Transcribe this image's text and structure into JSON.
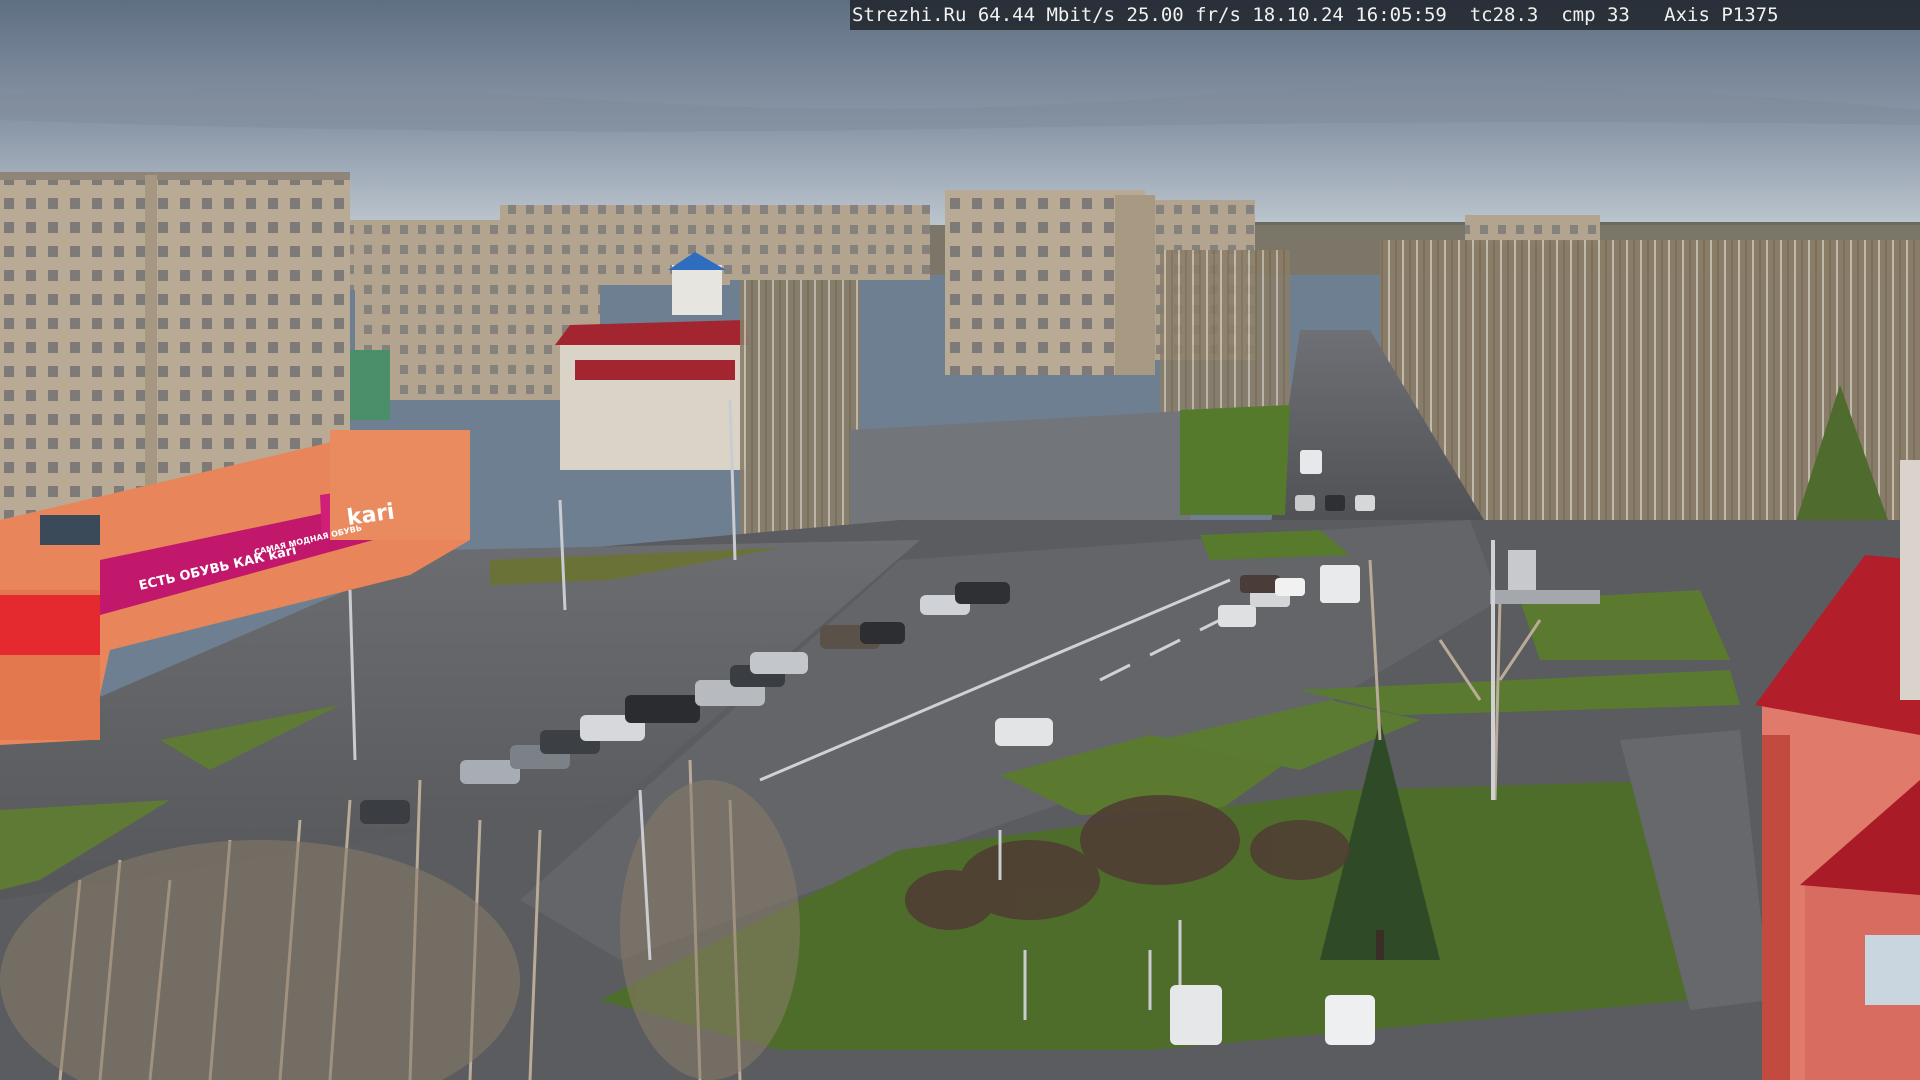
{
  "overlay": {
    "text": "Strezhi.Ru 64.44 Mbit/s 25.00 fr/s 18.10.24 16:05:59  tc28.3  cmp 33   Axis P1375"
  },
  "signs": {
    "store_logo": "kari",
    "store_banner_small": "САМАЯ МОДНАЯ ОБУВЬ",
    "store_banner_main": "ЕСТЬ ОБУВЬ КАК kari"
  },
  "colors": {
    "sky_top": "#5f6f83",
    "sky_horizon": "#c3ccd3",
    "store_magenta": "#c2186b",
    "store_wall": "#e8855a",
    "grass": "#5b7a2f",
    "asphalt": "#5b5d61",
    "red_roof": "#b21e2a"
  }
}
